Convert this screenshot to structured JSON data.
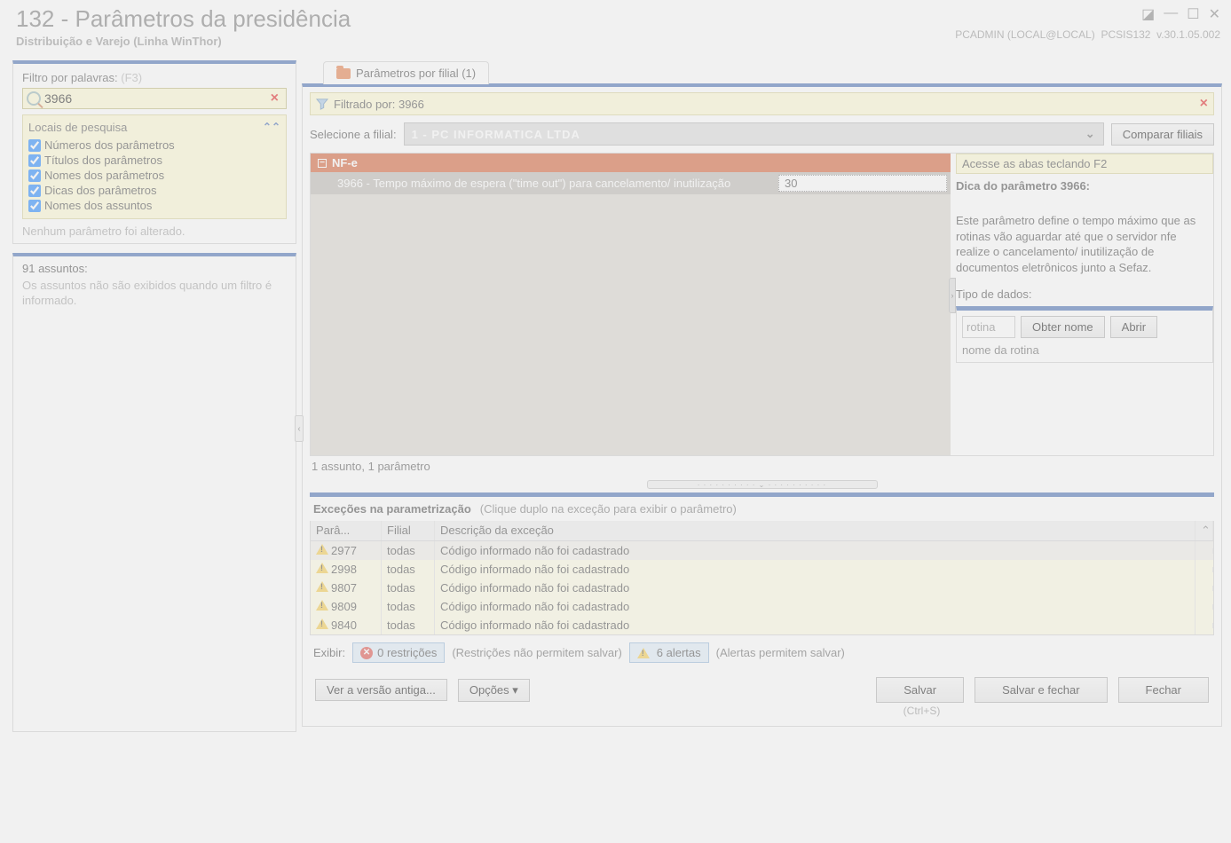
{
  "window": {
    "title": "132 - Parâmetros da presidência",
    "subtitle": "Distribuição e Varejo (Linha WinThor)",
    "user": "PCADMIN (LOCAL@LOCAL)",
    "program": "PCSIS132",
    "version": "v.30.1.05.002"
  },
  "filter": {
    "label": "Filtro por palavras:",
    "shortcut": "(F3)",
    "value": "3966",
    "locais_title": "Locais de pesquisa",
    "options": [
      "Números dos parâmetros",
      "Títulos dos parâmetros",
      "Nomes dos parâmetros",
      "Dicas dos parâmetros",
      "Nomes dos assuntos"
    ],
    "status": "Nenhum parâmetro foi alterado."
  },
  "assuntos": {
    "header": "91 assuntos:",
    "body": "Os assuntos não são exibidos quando um filtro é informado."
  },
  "tab": {
    "label": "Parâmetros por filial  (1)"
  },
  "filter_bar": {
    "text": "Filtrado por: 3966"
  },
  "filial": {
    "label": "Selecione a filial:",
    "selected": "1 - PC INFORMATICA LTDA",
    "compare_btn": "Comparar filiais"
  },
  "tree": {
    "group": "NF-e",
    "row_label": "3966 - Tempo máximo de espera (\"time out\") para cancelamento/ inutilização",
    "row_value": "30",
    "footer": "1 assunto, 1 parâmetro"
  },
  "info": {
    "note": "Acesse as abas teclando F2",
    "dica_head": "Dica do parâmetro 3966:",
    "dica_body": "Este parâmetro define o tempo máximo que as rotinas vão aguardar até que o servidor nfe realize o cancelamento/ inutilização de documentos eletrônicos junto a Sefaz.",
    "tipo_label": "Tipo de dados:"
  },
  "rotina": {
    "placeholder": "rotina",
    "obter": "Obter nome",
    "abrir": "Abrir",
    "nome": "nome da rotina"
  },
  "exc": {
    "title": "Exceções na parametrização",
    "hint": "(Clique duplo na exceção para exibir o parâmetro)",
    "cols": {
      "par": "Parâ...",
      "fil": "Filial",
      "desc": "Descrição da exceção"
    },
    "rows": [
      {
        "par": "2977",
        "fil": "todas",
        "desc": "Código informado não foi cadastrado"
      },
      {
        "par": "2998",
        "fil": "todas",
        "desc": "Código informado não foi cadastrado"
      },
      {
        "par": "9807",
        "fil": "todas",
        "desc": "Código informado não foi cadastrado"
      },
      {
        "par": "9809",
        "fil": "todas",
        "desc": "Código informado não foi cadastrado"
      },
      {
        "par": "9840",
        "fil": "todas",
        "desc": "Código informado não foi cadastrado"
      }
    ],
    "exibir_label": "Exibir:",
    "restr_btn": "0 restrições",
    "restr_hint": "(Restrições não permitem salvar)",
    "alert_btn": "6 alertas",
    "alert_hint": "(Alertas permitem salvar)"
  },
  "buttons": {
    "ver": "Ver a versão antiga...",
    "opcoes": "Opções ▾",
    "salvar": "Salvar",
    "salvar_fechar": "Salvar e fechar",
    "fechar": "Fechar",
    "salvar_shortcut": "(Ctrl+S)"
  }
}
